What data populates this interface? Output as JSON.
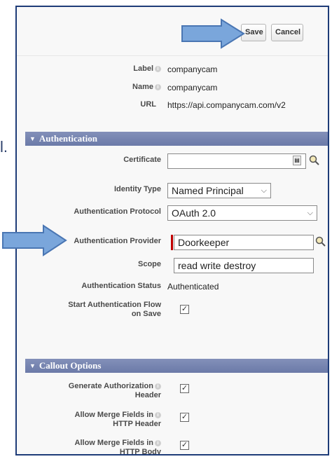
{
  "toolbar": {
    "save_label": "Save",
    "cancel_label": "Cancel"
  },
  "fields": {
    "label": {
      "label": "Label",
      "value": "companycam"
    },
    "name": {
      "label": "Name",
      "value": "companycam"
    },
    "url": {
      "label": "URL",
      "value": "https://api.companycam.com/v2"
    }
  },
  "authentication": {
    "section_title": "Authentication",
    "certificate": {
      "label": "Certificate",
      "value": ""
    },
    "identity_type": {
      "label": "Identity Type",
      "value": "Named Principal"
    },
    "protocol": {
      "label": "Authentication Protocol",
      "value": "OAuth 2.0"
    },
    "provider": {
      "label": "Authentication Provider",
      "value": "Doorkeeper"
    },
    "scope": {
      "label": "Scope",
      "value": "read write destroy"
    },
    "status": {
      "label": "Authentication Status",
      "value": "Authenticated"
    },
    "start_flow": {
      "label_line1": "Start Authentication Flow",
      "label_line2": "on Save",
      "checked": true
    }
  },
  "callout": {
    "section_title": "Callout Options",
    "generate_auth_header": {
      "label_line1": "Generate Authorization",
      "label_line2": "Header",
      "checked": true
    },
    "merge_http_header": {
      "label_line1": "Allow Merge Fields in",
      "label_line2": "HTTP Header",
      "checked": true
    },
    "merge_http_body": {
      "label_line1": "Allow Merge Fields in",
      "label_line2": "HTTP Body",
      "checked": true
    }
  },
  "side_text": "l.",
  "colors": {
    "border": "#1e3c78",
    "section": "#6b7aa8",
    "arrow": "#7aa6db",
    "required": "#c00000"
  },
  "icons": {
    "help": "help-icon",
    "lookup": "magnifier-icon",
    "arrow": "right-arrow-icon"
  }
}
